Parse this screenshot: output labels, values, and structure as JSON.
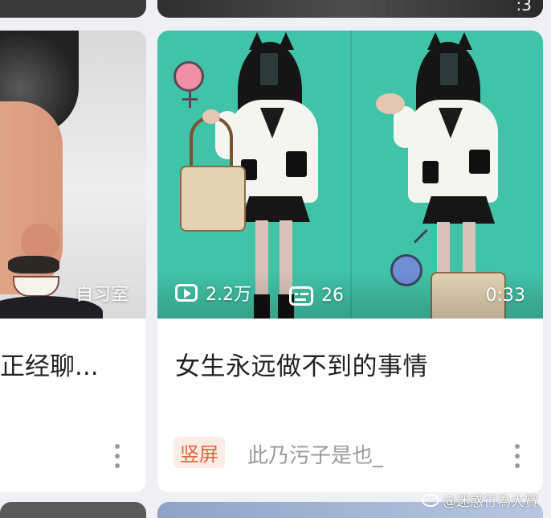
{
  "top": {
    "right_fragment": ":3"
  },
  "cards": [
    {
      "thumb_label": "自习室",
      "title": "正经聊..."
    },
    {
      "views": "2.2万",
      "danmaku": "26",
      "duration": "0:33",
      "title": "女生永远做不到的事情",
      "tag": "竖屏",
      "author": "此乃污子是也_"
    }
  ],
  "watermark": "@迷惑行為大賞",
  "colors": {
    "thumb_bg": "#41c3a7",
    "tag_bg": "#fdece5",
    "tag_text": "#e2643c",
    "venus": "#ef8fa6",
    "mars": "#6f8fd6"
  }
}
